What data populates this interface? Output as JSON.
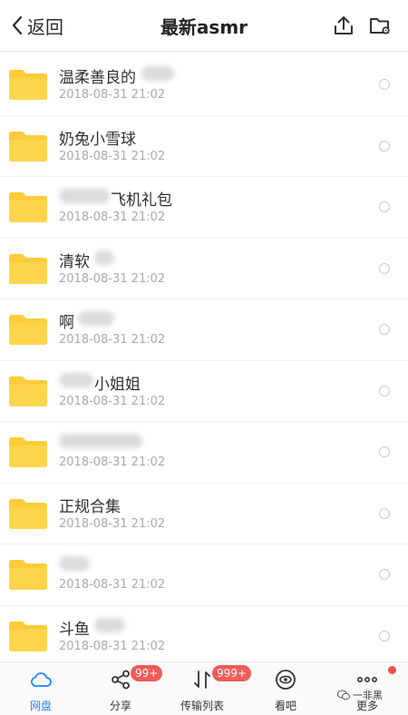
{
  "header": {
    "back_label": "返回",
    "title": "最新asmr",
    "upload_icon": "upload-icon",
    "folder_settings_icon": "folder-settings-icon"
  },
  "files": [
    {
      "name": "温柔善良的",
      "date": "2018-08-31 21:02"
    },
    {
      "name": "奶兔小雪球",
      "date": "2018-08-31 21:02"
    },
    {
      "name": "飞机礼包",
      "date": "2018-08-31 21:02"
    },
    {
      "name": "清软",
      "date": "2018-08-31 21:02"
    },
    {
      "name": "啊",
      "date": "2018-08-31 21:02"
    },
    {
      "name": "小姐姐",
      "date": "2018-08-31 21:02"
    },
    {
      "name": "",
      "date": "2018-08-31 21:02"
    },
    {
      "name": "正规合集",
      "date": "2018-08-31 21:02"
    },
    {
      "name": "",
      "date": "2018-08-31 21:02"
    },
    {
      "name": "斗鱼",
      "date": "2018-08-31 21:02"
    }
  ],
  "tabs": [
    {
      "label": "网盘",
      "icon": "cloud-icon",
      "active": true
    },
    {
      "label": "分享",
      "icon": "share-icon",
      "badge": "99+"
    },
    {
      "label": "传输列表",
      "icon": "transfer-icon",
      "badge": "999+"
    },
    {
      "label": "看吧",
      "icon": "eye-icon"
    },
    {
      "label": "更多",
      "icon": "more-icon",
      "dot": true
    }
  ],
  "watermark": "一非黑",
  "colors": {
    "accent": "#1f86ff",
    "folder": "#fccc3a",
    "badge": "#f25b5b"
  }
}
